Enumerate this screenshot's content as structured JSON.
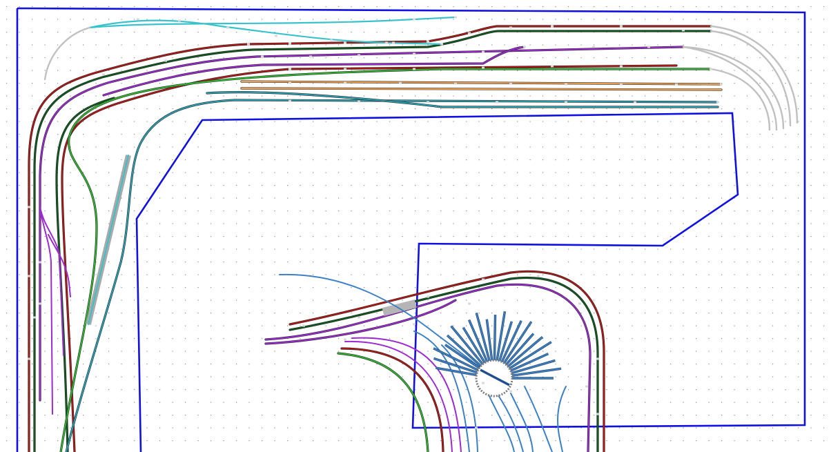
{
  "diagram": {
    "kind": "model railway track plan",
    "colors": {
      "background": "#ffffff",
      "grid_dot": "#8a8a8a",
      "baseboard_outline": "#1010e0",
      "red": "#b01818",
      "dark_green": "#0e5a1e",
      "green": "#2fb52f",
      "purple": "#9b2bd0",
      "teal": "#2a9fb0",
      "cyan": "#39c2cc",
      "blue": "#3b7fc4",
      "orange": "#f0a050",
      "grey": "#c0c0c0",
      "turntable": "#606060"
    },
    "turntable_roads": 22,
    "icons": [
      "turntable-icon",
      "track-joint-marker-icon",
      "buffer-stop-icon"
    ]
  }
}
